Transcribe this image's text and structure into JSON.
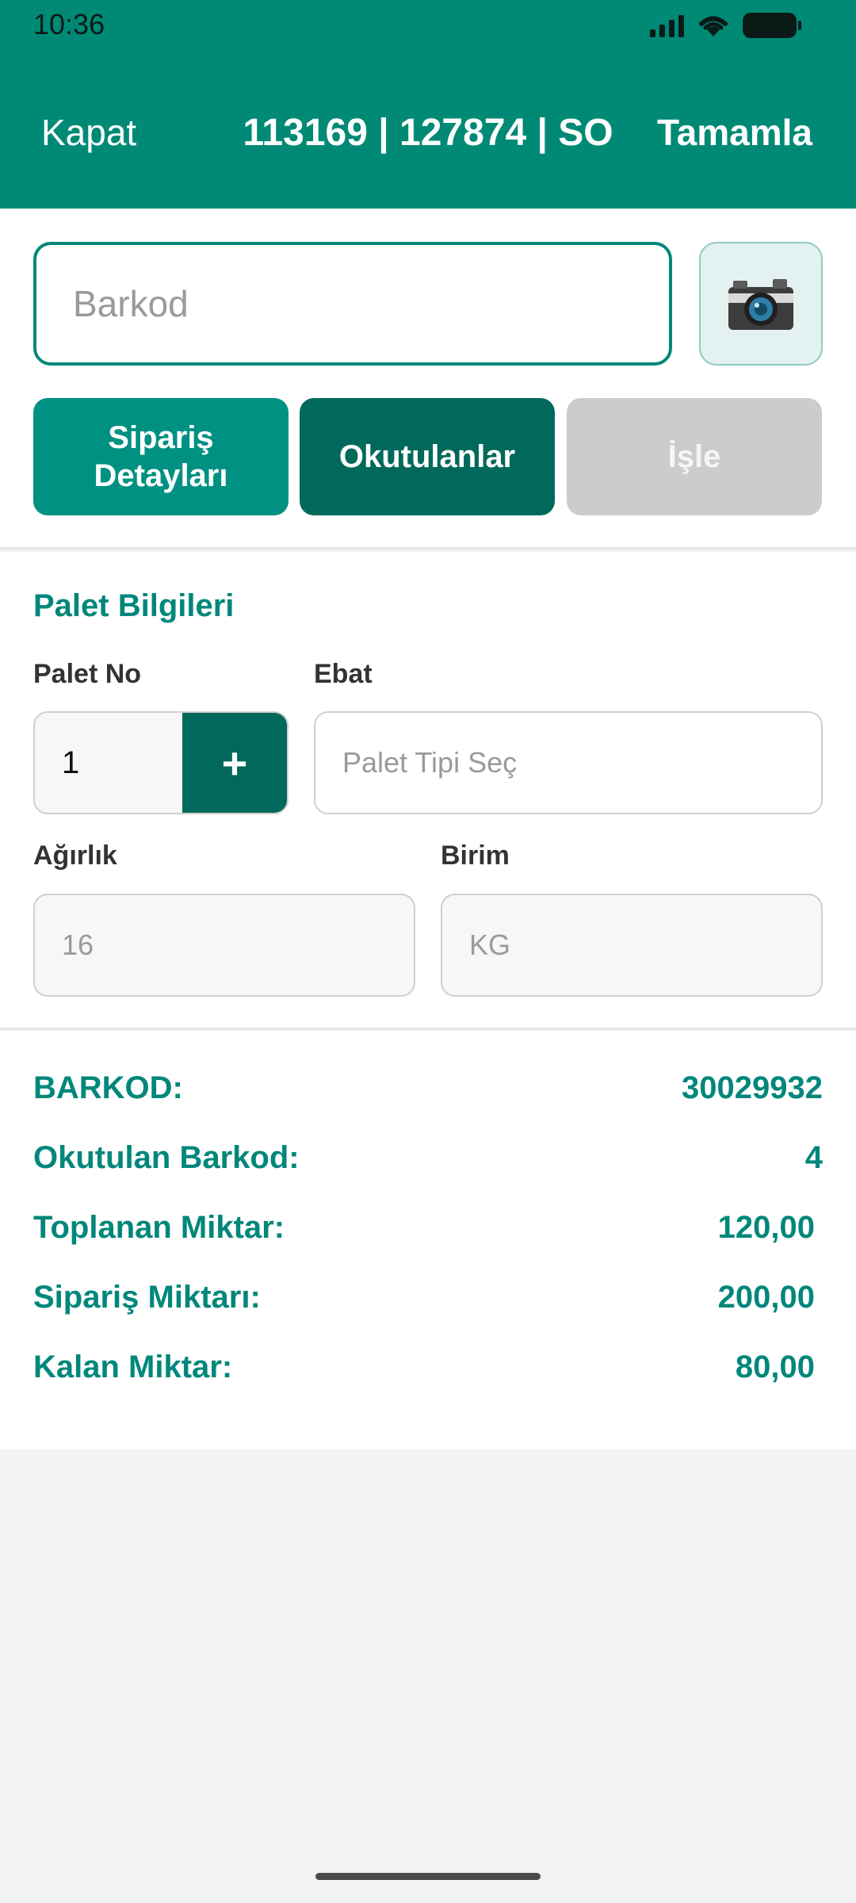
{
  "status_bar": {
    "time": "10:36"
  },
  "nav": {
    "left": "Kapat",
    "title": "113169 | 127874 | SO",
    "right": "Tamamla"
  },
  "barcode": {
    "placeholder": "Barkod",
    "camera_icon": "camera-icon"
  },
  "tabs": [
    {
      "label": "Sipariş\nDetayları"
    },
    {
      "label": "Okutulanlar"
    },
    {
      "label": "İşle"
    }
  ],
  "palet": {
    "section_title": "Palet Bilgileri",
    "palet_no_label": "Palet No",
    "palet_no_value": "1",
    "plus": "+",
    "ebat_label": "Ebat",
    "ebat_placeholder": "Palet Tipi Seç",
    "agirlik_label": "Ağırlık",
    "agirlik_value": "16",
    "birim_label": "Birim",
    "birim_value": "KG"
  },
  "summary": {
    "rows": [
      {
        "label": "BARKOD:",
        "value": "30029932"
      },
      {
        "label": "Okutulan Barkod:",
        "value": "4"
      },
      {
        "label": "Toplanan Miktar:",
        "value": "120,00"
      },
      {
        "label": "Sipariş Miktarı:",
        "value": "200,00"
      },
      {
        "label": "Kalan Miktar:",
        "value": "80,00"
      }
    ]
  },
  "colors": {
    "primary": "#008a76",
    "dark_primary": "#00695c",
    "disabled": "#cccccc"
  }
}
